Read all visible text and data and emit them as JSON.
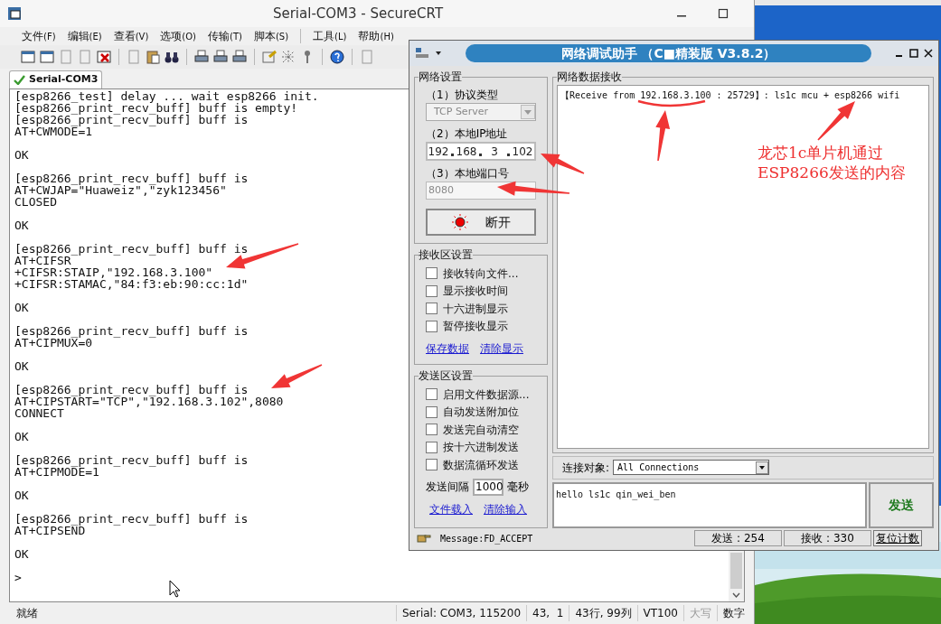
{
  "secure_crt": {
    "title": "Serial-COM3 - SecureCRT",
    "menu": [
      {
        "label": "文件",
        "key": "(F)"
      },
      {
        "label": "编辑",
        "key": "(E)"
      },
      {
        "label": "查看",
        "key": "(V)"
      },
      {
        "label": "选项",
        "key": "(O)"
      },
      {
        "label": "传输",
        "key": "(T)"
      },
      {
        "label": "脚本",
        "key": "(S)"
      },
      {
        "label": "工具",
        "key": "(L)"
      },
      {
        "label": "帮助",
        "key": "(H)"
      }
    ],
    "tab": {
      "label": "Serial-COM3",
      "selected": true
    },
    "terminal": {
      "blocks": [
        [
          "[esp8266_test] delay ... wait esp8266 init.",
          "[esp8266_print_recv_buff] buff is empty!",
          "[esp8266_print_recv_buff] buff is",
          "AT+CWMODE=1"
        ],
        [
          "OK"
        ],
        [
          "[esp8266_print_recv_buff] buff is",
          "AT+CWJAP=\"Huaweiz\",\"zyk123456\"",
          "CLOSED"
        ],
        [
          "OK"
        ],
        [
          "[esp8266_print_recv_buff] buff is",
          "AT+CIFSR",
          "+CIFSR:STAIP,\"192.168.3.100\"",
          "+CIFSR:STAMAC,\"84:f3:eb:90:cc:1d\""
        ],
        [
          "OK"
        ],
        [
          "[esp8266_print_recv_buff] buff is",
          "AT+CIPMUX=0"
        ],
        [
          "OK"
        ],
        [
          "[esp8266_print_recv_buff] buff is",
          "AT+CIPSTART=\"TCP\",\"192.168.3.102\",8080",
          "CONNECT"
        ],
        [
          "OK"
        ],
        [
          "[esp8266_print_recv_buff] buff is",
          "AT+CIPMODE=1"
        ],
        [
          "OK"
        ],
        [
          "[esp8266_print_recv_buff] buff is",
          "AT+CIPSEND"
        ],
        [
          "OK"
        ],
        [
          ">"
        ]
      ]
    },
    "status_bar": [
      {
        "text": "就绪",
        "disabled": false
      },
      {
        "text": "Serial: COM3, 115200",
        "disabled": false
      },
      {
        "text": "43,  1",
        "disabled": false
      },
      {
        "text": "43行, 99列",
        "disabled": false
      },
      {
        "text": "VT100",
        "disabled": false
      },
      {
        "text": "大写",
        "disabled": true
      },
      {
        "text": "数字",
        "disabled": false
      }
    ]
  },
  "net_assistant": {
    "title": "网络调试助手 （C■精装版 V3.8.2）",
    "network_settings": {
      "title": "网络设置",
      "protocol_label": "（1）协议类型",
      "protocol": {
        "value": "TCP Server",
        "disabled": true
      },
      "ip_label": "（2）本地IP地址",
      "ip": [
        "192",
        "168",
        "3",
        "102"
      ],
      "port_label": "（3）本地端口号",
      "port": {
        "value": "8080",
        "disabled": true
      },
      "connect_button": "断开"
    },
    "receive_settings": {
      "title": "接收区设置",
      "options": [
        {
          "label": "接收转向文件...",
          "checked": false
        },
        {
          "label": "显示接收时间",
          "checked": false
        },
        {
          "label": "十六进制显示",
          "checked": false
        },
        {
          "label": "暂停接收显示",
          "checked": false
        }
      ],
      "links": [
        "保存数据",
        "清除显示"
      ]
    },
    "send_settings": {
      "title": "发送区设置",
      "options": [
        {
          "label": "启用文件数据源...",
          "checked": false
        },
        {
          "label": "自动发送附加位",
          "checked": false
        },
        {
          "label": "发送完自动清空",
          "checked": false
        },
        {
          "label": "按十六进制发送",
          "checked": false
        },
        {
          "label": "数据流循环发送",
          "checked": false
        }
      ],
      "interval_label": "发送间隔",
      "interval": "1000",
      "interval_unit": "毫秒",
      "links": [
        "文件载入",
        "清除输入"
      ]
    },
    "receive_area": {
      "title": "网络数据接收",
      "lines": [
        "【Receive from 192.168.3.100 : 25729】: ls1c mcu + esp8266 wifi"
      ]
    },
    "target": {
      "label": "连接对象:",
      "value": "All Connections"
    },
    "send_text": "hello ls1c qin_wei_ben",
    "send_button": "发送",
    "message": "Message:FD_ACCEPT",
    "sent": "发送 : 254",
    "received": "接收 : 330",
    "reset_button": "复位计数"
  },
  "annotation": {
    "lines": [
      "龙芯1c单片机通过",
      "ESP8266发送的内容"
    ]
  }
}
